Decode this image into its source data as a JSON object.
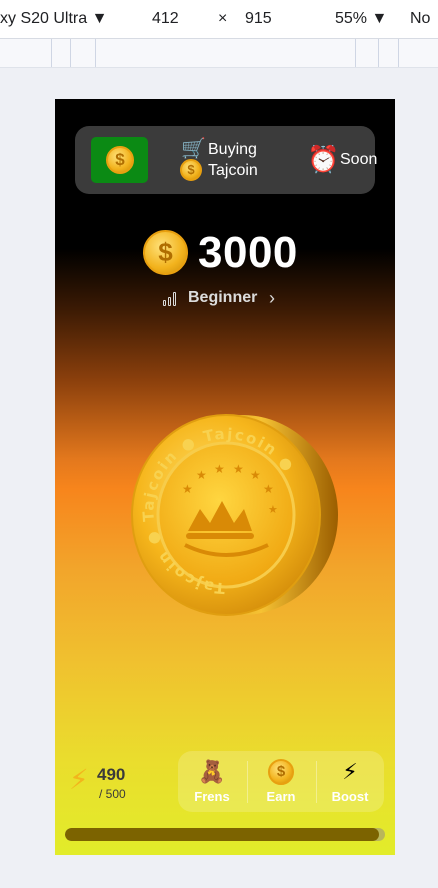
{
  "devtools": {
    "device": "xy S20 Ultra",
    "width": "412",
    "times": "×",
    "height": "915",
    "zoom": "55%",
    "throttle": "No"
  },
  "topcard": {
    "buying_line1": "Buying",
    "buying_line2": "Tajcoin",
    "soon": "Soon",
    "flag_color": "#0b8a14"
  },
  "balance": {
    "value": "3000"
  },
  "level": {
    "name": "Beginner"
  },
  "coin": {
    "ring_text": "Tajcoin ● Tajcoin ● Tajcoin ●"
  },
  "energy": {
    "current": "490",
    "max": "/ 500"
  },
  "nav": {
    "frens": "Frens",
    "earn": "Earn",
    "boost": "Boost"
  },
  "progress": {
    "fraction": 0.98
  },
  "colors": {
    "accent": "#f7851c",
    "gold": "#f2b21c"
  }
}
